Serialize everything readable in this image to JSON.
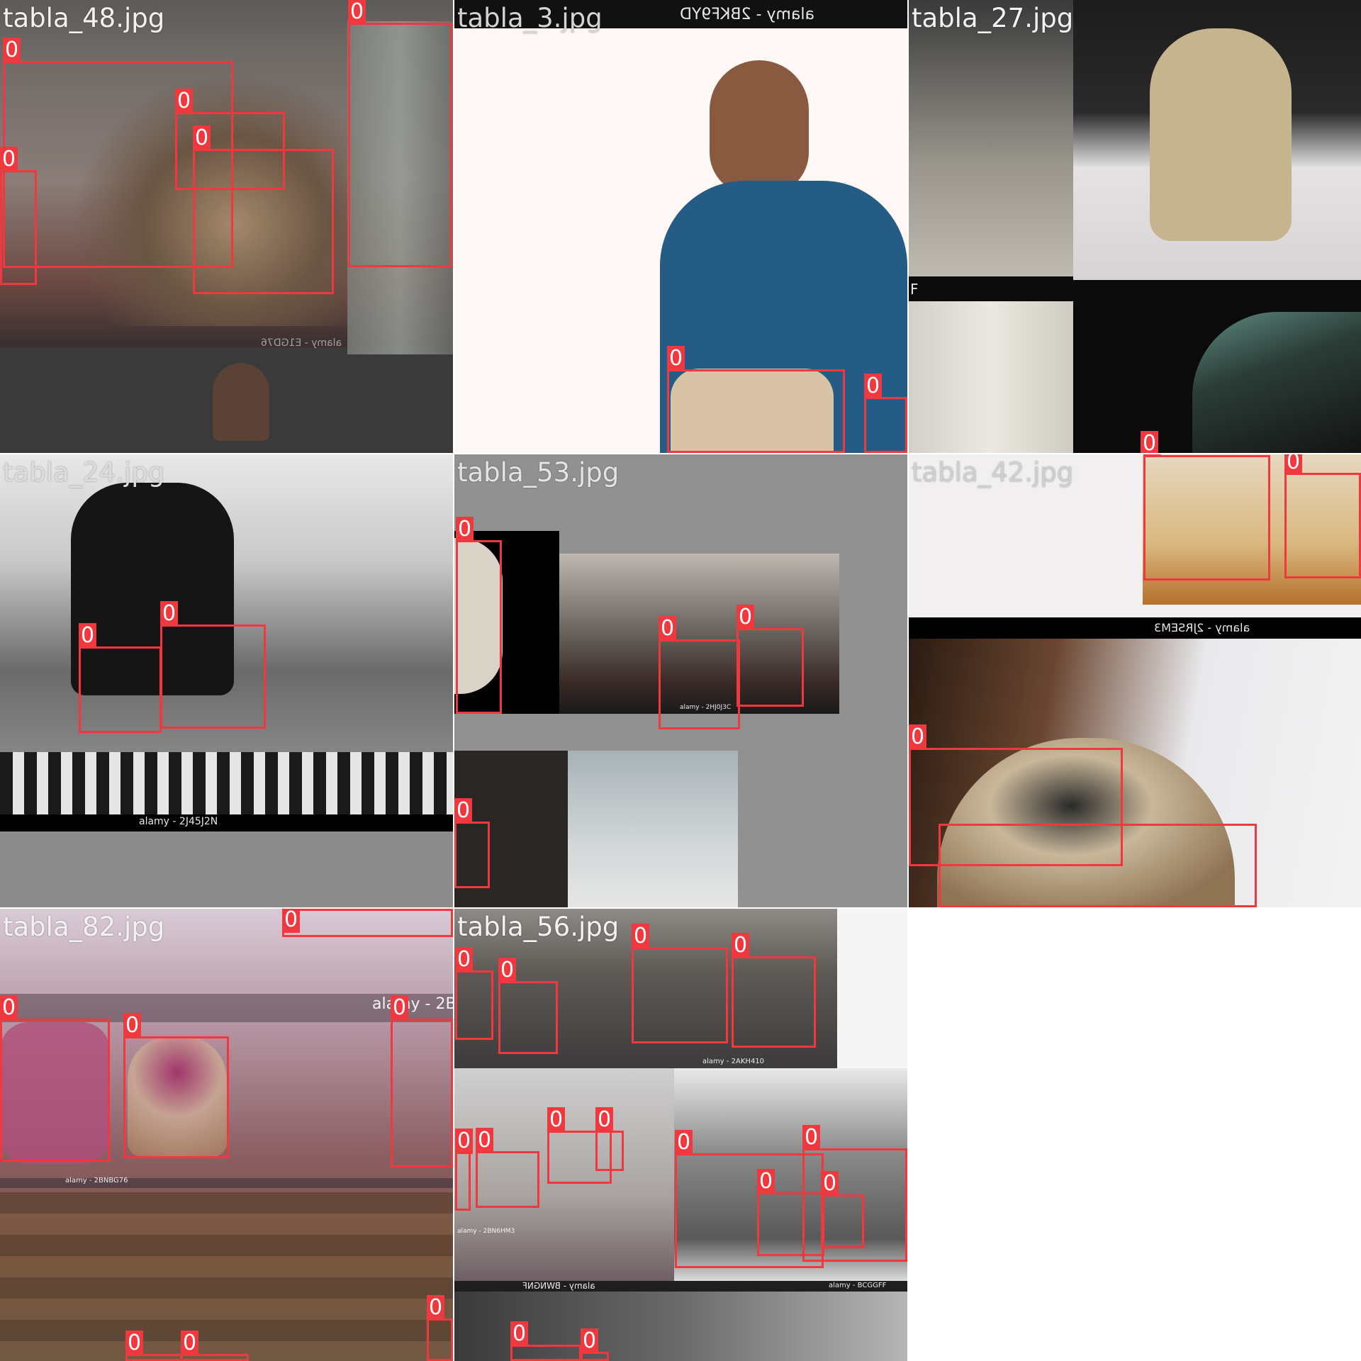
{
  "tiles": [
    {
      "id": "tabla_48",
      "title": "tabla_48.jpg",
      "watermarks": [
        "alamy - E1GD76"
      ],
      "boxes": [
        "0",
        "0",
        "0",
        "0",
        "0"
      ]
    },
    {
      "id": "tabla_3",
      "title": "tabla_3.jpg",
      "watermarks": [
        "alamy - 2BKF9YD"
      ],
      "boxes": [
        "0",
        "0"
      ]
    },
    {
      "id": "tabla_27",
      "title": "tabla_27.jpg",
      "watermarks": [
        "F"
      ],
      "boxes": [
        "0"
      ]
    },
    {
      "id": "tabla_24",
      "title": "tabla_24.jpg",
      "watermarks": [
        "alamy - 2J45J2N"
      ],
      "boxes": [
        "0",
        "0"
      ]
    },
    {
      "id": "tabla_53",
      "title": "tabla_53.jpg",
      "watermarks": [
        "alamy - 2HJ0J3C"
      ],
      "boxes": [
        "0",
        "0",
        "0",
        "0"
      ]
    },
    {
      "id": "tabla_42",
      "title": "tabla_42.jpg",
      "watermarks": [
        "alamy - 2JRSEM3"
      ],
      "boxes": [
        "0",
        "0",
        "0"
      ]
    },
    {
      "id": "tabla_82",
      "title": "tabla_82.jpg",
      "watermarks": [
        "alamy - 2B",
        "alamy - 2BNBG76"
      ],
      "boxes": [
        "0",
        "0",
        "0",
        "0",
        "0",
        "0",
        "0"
      ]
    },
    {
      "id": "tabla_56",
      "title": "tabla_56.jpg",
      "watermarks": [
        "alamy - 2AKH410",
        "alamy - 2BN6HM3",
        "alamy - BWNGNF",
        "alamy - BCGGFF"
      ],
      "boxes": [
        "0",
        "0",
        "0",
        "0",
        "0",
        "0",
        "0",
        "0",
        "0",
        "0",
        "0",
        "0",
        "0",
        "0"
      ]
    }
  ],
  "colors": {
    "box": "#f0383e",
    "title": "#f2f2f2",
    "background": "#ffffff"
  }
}
